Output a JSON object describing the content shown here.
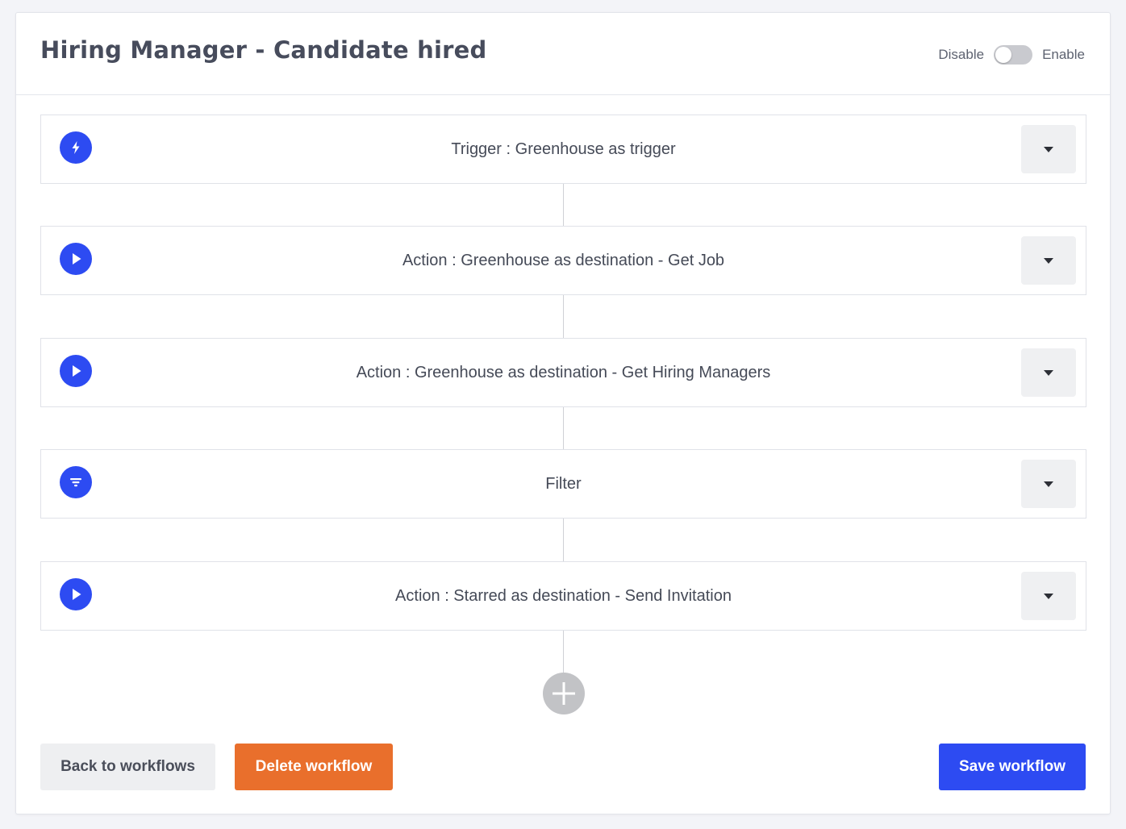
{
  "header": {
    "title": "Hiring Manager - Candidate hired",
    "toggle": {
      "off_label": "Disable",
      "on_label": "Enable",
      "state": "disabled"
    }
  },
  "steps": [
    {
      "label": "Trigger : Greenhouse as trigger",
      "icon": "lightning-bolt-icon"
    },
    {
      "label": "Action : Greenhouse as destination - Get Job",
      "icon": "play-icon"
    },
    {
      "label": "Action : Greenhouse as destination - Get Hiring Managers",
      "icon": "play-icon"
    },
    {
      "label": "Filter",
      "icon": "filter-icon"
    },
    {
      "label": "Action : Starred as destination - Send Invitation",
      "icon": "play-icon"
    }
  ],
  "add_step_icon": "plus-icon",
  "footer": {
    "back_label": "Back to workflows",
    "delete_label": "Delete workflow",
    "save_label": "Save workflow"
  },
  "colors": {
    "accent": "#2d4bf2",
    "danger": "#e96f2c",
    "neutral_button": "#eeeff1",
    "toggle_off": "#c9cacf",
    "add_button": "#c2c3c6"
  }
}
